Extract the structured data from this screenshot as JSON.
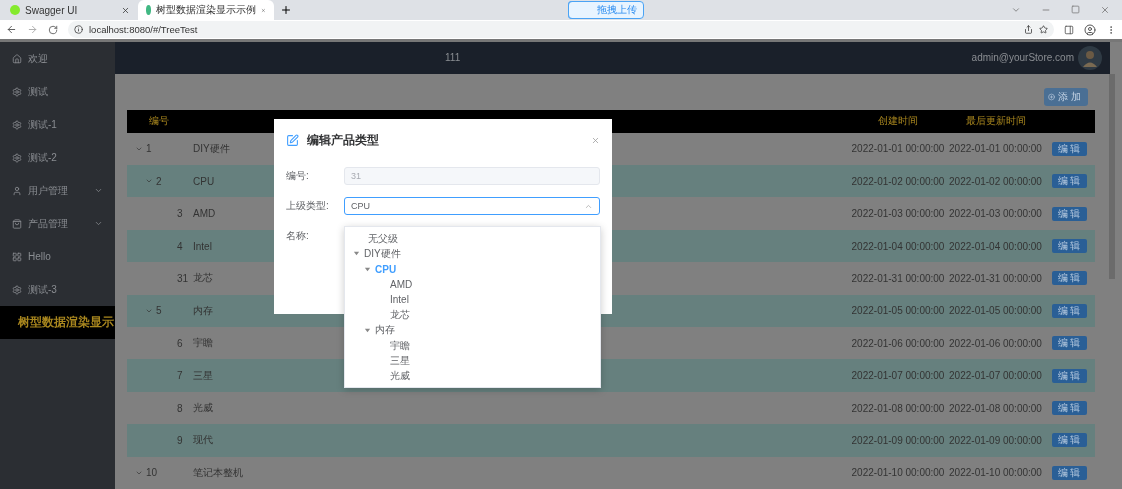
{
  "browser": {
    "tabs": [
      {
        "title": "Swagger UI",
        "selected": false
      },
      {
        "title": "树型数据渲染显示示例",
        "selected": true
      }
    ],
    "extension_button": "拖拽上传",
    "address": "localhost:8080/#/TreeTest"
  },
  "sidebar": {
    "items": [
      {
        "label": "欢迎",
        "expandable": false,
        "selected": false
      },
      {
        "label": "测试",
        "expandable": false,
        "selected": false
      },
      {
        "label": "测试-1",
        "expandable": false,
        "selected": false
      },
      {
        "label": "测试-2",
        "expandable": false,
        "selected": false
      },
      {
        "label": "用户管理",
        "expandable": true,
        "selected": false
      },
      {
        "label": "产品管理",
        "expandable": true,
        "selected": false
      },
      {
        "label": "Hello",
        "expandable": false,
        "selected": false
      },
      {
        "label": "测试-3",
        "expandable": false,
        "selected": false
      },
      {
        "label": "树型数据渲染显示",
        "expandable": false,
        "selected": true
      }
    ]
  },
  "header": {
    "title": "111",
    "user": "admin@yourStore.com"
  },
  "add_button": "添加",
  "table": {
    "columns": [
      "编号",
      "创建时间",
      "最后更新时间"
    ],
    "rows": [
      {
        "id": "1",
        "name": "DIY硬件",
        "created": "2022-01-01 00:00:00",
        "updated": "2022-01-01 00:00:00",
        "action": "编 辑",
        "expanded": true,
        "children": [
          {
            "id": "2",
            "name": "CPU",
            "created": "2022-01-02 00:00:00",
            "updated": "2022-01-02 00:00:00",
            "action": "编 辑",
            "expanded": true,
            "children": [
              {
                "id": "3",
                "name": "AMD",
                "created": "2022-01-03 00:00:00",
                "updated": "2022-01-03 00:00:00",
                "action": "编 辑"
              },
              {
                "id": "4",
                "name": "Intel",
                "created": "2022-01-04 00:00:00",
                "updated": "2022-01-04 00:00:00",
                "action": "编 辑"
              },
              {
                "id": "31",
                "name": "龙芯",
                "created": "2022-01-31 00:00:00",
                "updated": "2022-01-31 00:00:00",
                "action": "编 辑"
              }
            ]
          },
          {
            "id": "5",
            "name": "内存",
            "created": "2022-01-05 00:00:00",
            "updated": "2022-01-05 00:00:00",
            "action": "编 辑",
            "expanded": true,
            "children": [
              {
                "id": "6",
                "name": "宇瞻",
                "created": "2022-01-06 00:00:00",
                "updated": "2022-01-06 00:00:00",
                "action": "编 辑"
              },
              {
                "id": "7",
                "name": "三星",
                "created": "2022-01-07 00:00:00",
                "updated": "2022-01-07 00:00:00",
                "action": "编 辑"
              },
              {
                "id": "8",
                "name": "光威",
                "created": "2022-01-08 00:00:00",
                "updated": "2022-01-08 00:00:00",
                "action": "编 辑"
              },
              {
                "id": "9",
                "name": "现代",
                "created": "2022-01-09 00:00:00",
                "updated": "2022-01-09 00:00:00",
                "action": "编 辑"
              }
            ]
          }
        ]
      },
      {
        "id": "10",
        "name": "笔记本整机",
        "created": "2022-01-10 00:00:00",
        "updated": "2022-01-10 00:00:00",
        "action": "编 辑",
        "expanded": true
      }
    ]
  },
  "dialog": {
    "title": "编辑产品类型",
    "fields": [
      {
        "label": "编号:",
        "value": "31",
        "disabled": true
      },
      {
        "label": "上级类型:",
        "value": "CPU",
        "disabled": false
      },
      {
        "label": "名称:"
      }
    ],
    "dropdown": [
      {
        "label": "无父级",
        "selected": false
      },
      {
        "label": "DIY硬件",
        "selected": false,
        "expanded": true,
        "children": [
          {
            "label": "CPU",
            "selected": true,
            "expanded": true,
            "children": [
              {
                "label": "AMD",
                "selected": false
              },
              {
                "label": "Intel",
                "selected": false
              },
              {
                "label": "龙芯",
                "selected": false
              }
            ]
          },
          {
            "label": "内存",
            "selected": false,
            "expanded": true,
            "children": [
              {
                "label": "宇瞻",
                "selected": false
              },
              {
                "label": "三星",
                "selected": false
              },
              {
                "label": "光威",
                "selected": false
              }
            ]
          }
        ]
      }
    ]
  }
}
